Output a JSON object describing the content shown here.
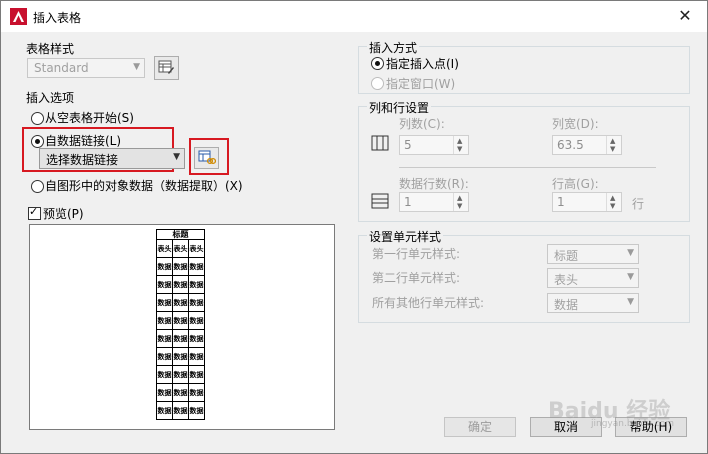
{
  "window": {
    "title": "插入表格",
    "close_glyph": "✕"
  },
  "table_style": {
    "group_label": "表格样式",
    "combo_value": "Standard"
  },
  "insert_options": {
    "group_label": "插入选项",
    "opt_empty": "从空表格开始(S)",
    "opt_datalink": "自数据链接(L)",
    "datalink_combo_value": "选择数据链接",
    "opt_extract": "自图形中的对象数据（数据提取）(X)"
  },
  "preview": {
    "label": "预览(P)",
    "table": {
      "title": "标题",
      "header": [
        "表头",
        "表头",
        "表头"
      ],
      "cell": "数据",
      "data_rows": 9
    }
  },
  "insert_method": {
    "group_label": "插入方式",
    "opt_point": "指定插入点(I)",
    "opt_window": "指定窗口(W)"
  },
  "row_col": {
    "group_label": "列和行设置",
    "columns_label": "列数(C):",
    "columns_value": "5",
    "col_width_label": "列宽(D):",
    "col_width_value": "63.5",
    "data_rows_label": "数据行数(R):",
    "data_rows_value": "1",
    "row_height_label": "行高(G):",
    "row_height_value": "1",
    "row_height_unit": "行"
  },
  "cell_styles": {
    "group_label": "设置单元样式",
    "first_row_label": "第一行单元样式:",
    "first_row_value": "标题",
    "second_row_label": "第二行单元样式:",
    "second_row_value": "表头",
    "others_label": "所有其他行单元样式:",
    "others_value": "数据"
  },
  "buttons": {
    "ok": "确定",
    "cancel": "取消",
    "help": "帮助(H)"
  },
  "watermark": {
    "text": "Baidu 经验",
    "url": "jingyan.baidu.com"
  },
  "colors": {
    "highlight": "#d71921",
    "app_icon": "#c8102e"
  }
}
